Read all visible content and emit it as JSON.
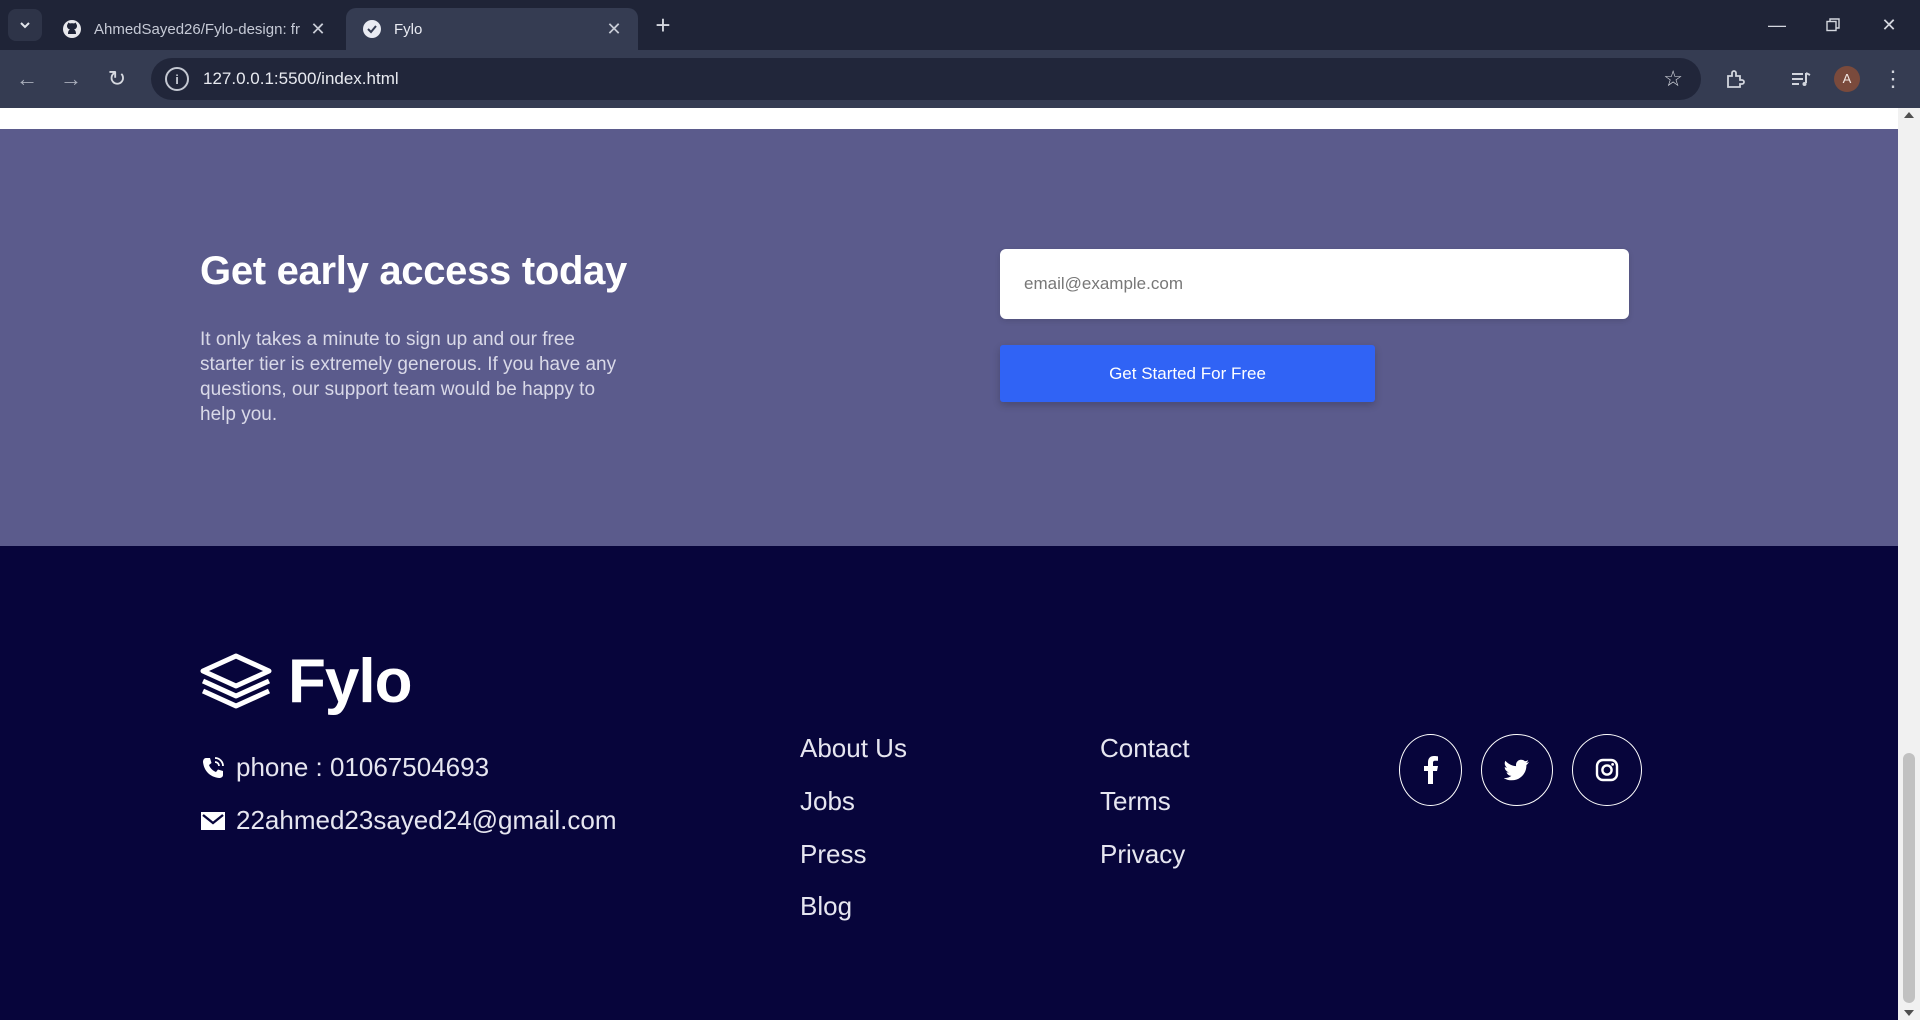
{
  "browser": {
    "tabs": [
      {
        "title": "AhmedSayed26/Fylo-design: fr",
        "favicon": "github-icon",
        "active": false
      },
      {
        "title": "Fylo",
        "favicon": "globe-icon",
        "active": true
      }
    ],
    "url": "127.0.0.1:5500/index.html",
    "profile_initial": "A"
  },
  "cta": {
    "heading": "Get early access today",
    "text": "It only takes a minute to sign up and our free starter tier is extremely generous. If you have any questions, our support team would be happy to help you.",
    "email_placeholder": "email@example.com",
    "button_label": "Get Started For Free"
  },
  "footer": {
    "logo_text": "Fylo",
    "phone": "phone : 01067504693",
    "email": "22ahmed23sayed24@gmail.com",
    "links_col1": [
      "About Us",
      "Jobs",
      "Press",
      "Blog"
    ],
    "links_col2": [
      "Contact",
      "Terms",
      "Privacy"
    ],
    "social": [
      "facebook-icon",
      "twitter-icon",
      "instagram-icon"
    ]
  },
  "colors": {
    "cta_bg": "#5b5b8c",
    "footer_bg": "#07053b",
    "button": "#3063f5",
    "chrome_tabbar": "#1f2437",
    "chrome_toolbar": "#353c52"
  }
}
